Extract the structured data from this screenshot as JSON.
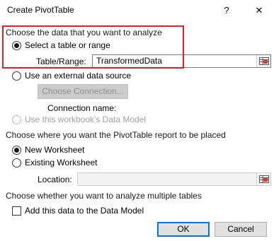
{
  "window": {
    "title": "Create PivotTable",
    "help_label": "?",
    "close_label": "✕"
  },
  "section_data": {
    "heading": "Choose the data that you want to analyze",
    "option_table": {
      "label": "Select a table or range",
      "selected": true
    },
    "table_range": {
      "label": "Table/Range:",
      "value": "TransformedData"
    },
    "option_external": {
      "label": "Use an external data source",
      "selected": false
    },
    "choose_connection_label": "Choose Connection...",
    "connection_name_label": "Connection name:",
    "option_data_model": {
      "label": "Use this workbook's Data Model",
      "selected": false,
      "disabled": true
    }
  },
  "section_placement": {
    "heading": "Choose where you want the PivotTable report to be placed",
    "option_new": {
      "label": "New Worksheet",
      "selected": true
    },
    "option_existing": {
      "label": "Existing Worksheet",
      "selected": false
    },
    "location": {
      "label": "Location:",
      "value": ""
    }
  },
  "section_multiple": {
    "heading": "Choose whether you want to analyze multiple tables",
    "add_to_model": {
      "label": "Add this data to the Data Model",
      "checked": false
    }
  },
  "footer": {
    "ok_label": "OK",
    "cancel_label": "Cancel"
  },
  "colors": {
    "highlight": "#e02028",
    "default_button_border": "#0078d7"
  },
  "icons": {
    "range_selector": "range-selector-icon"
  }
}
